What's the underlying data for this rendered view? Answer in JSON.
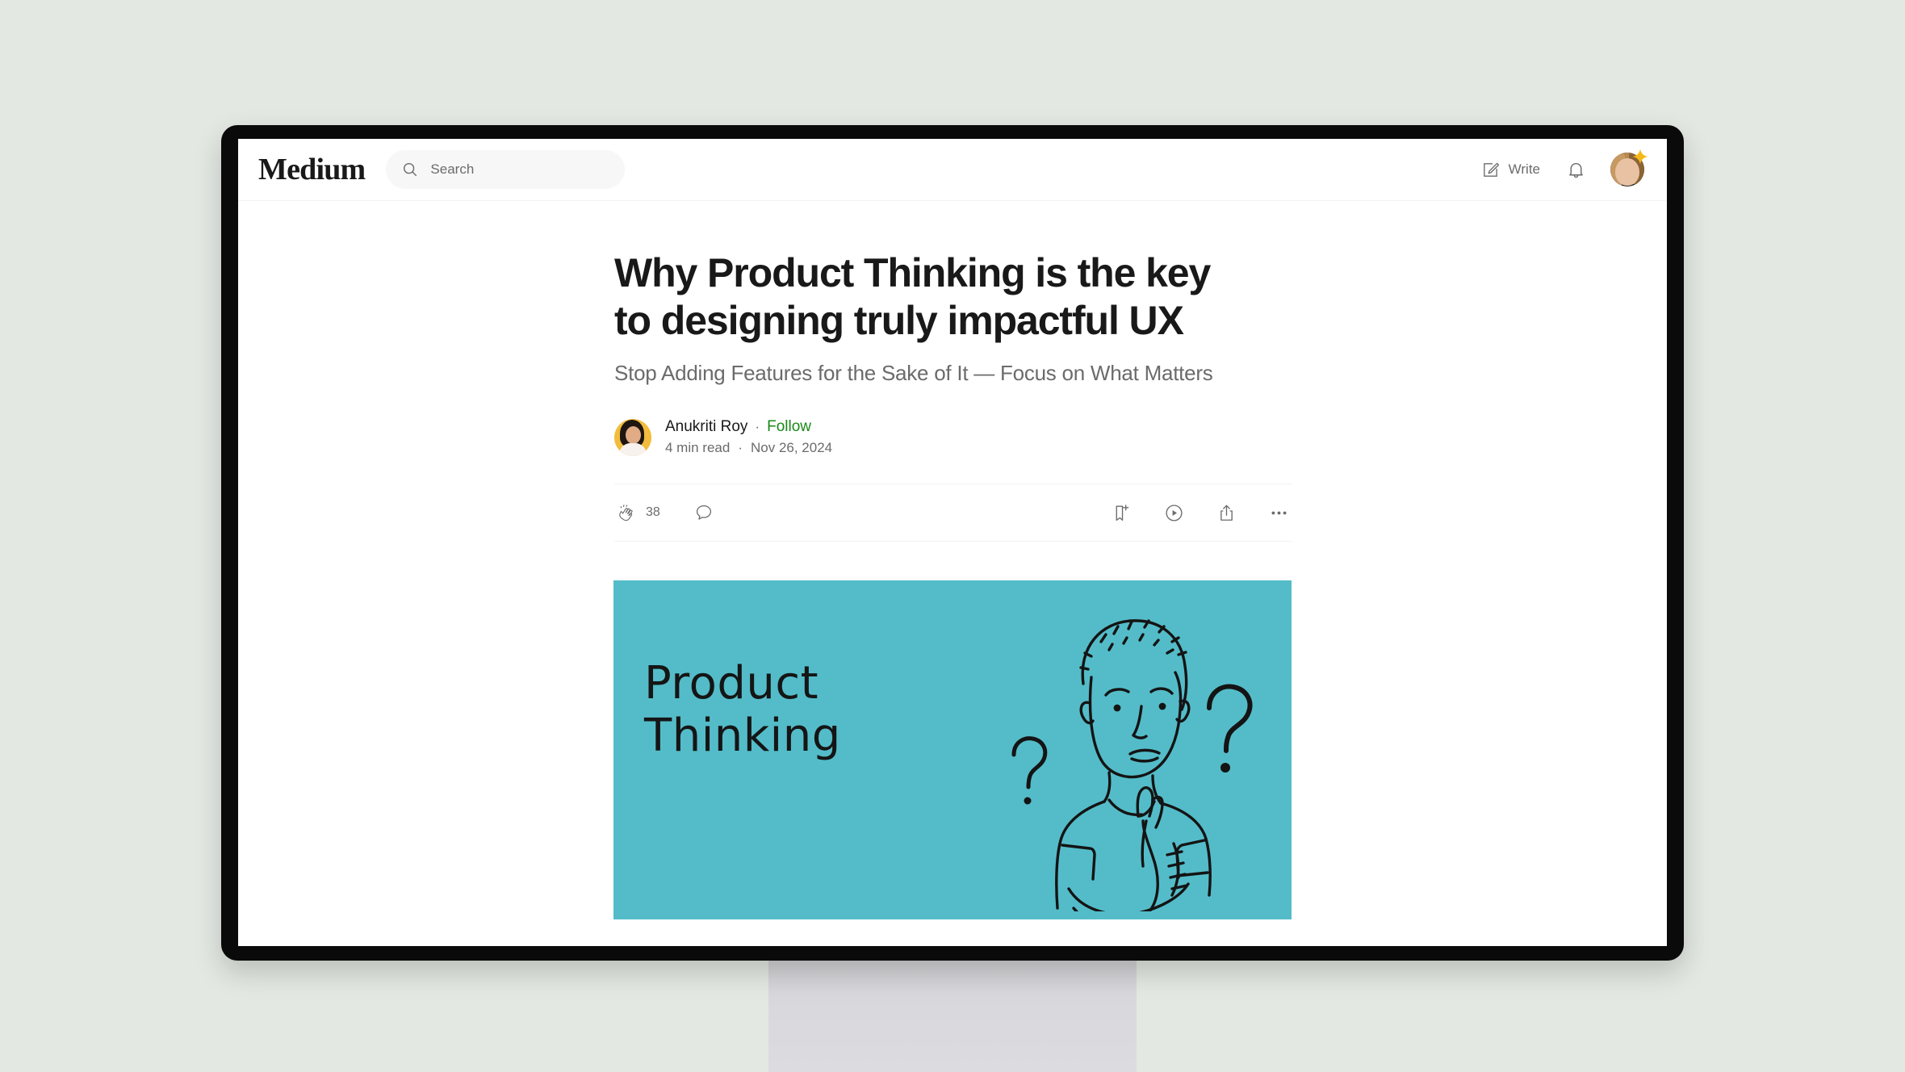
{
  "theme": {
    "page_background": "#e3e8e2",
    "bezel": "#0a0a0a",
    "stand": "#d8d8dc",
    "accent_green": "#1a8917",
    "hero_teal": "#54bcc9",
    "text_primary": "#191919",
    "text_secondary": "#6b6b6b",
    "sparkle_yellow": "#f5b816"
  },
  "nav": {
    "logo": "Medium",
    "search": {
      "placeholder": "Search",
      "value": "",
      "icon": "search-icon"
    },
    "write": {
      "label": "Write",
      "icon": "write-pencil-icon"
    },
    "notifications": {
      "icon": "bell-icon"
    },
    "avatar": {
      "name": "user-avatar",
      "badge_icon": "sparkle-icon"
    }
  },
  "article": {
    "title": "Why Product Thinking is the key to designing truly impactful UX",
    "subtitle": "Stop Adding Features for the Sake of It — Focus on What Matters",
    "author": {
      "name": "Anukriti Roy",
      "follow_label": "Follow",
      "separator": "·"
    },
    "meta": {
      "read_time": "4 min read",
      "separator": "·",
      "date": "Nov 26, 2024"
    },
    "actions": {
      "clap": {
        "icon": "clap-icon",
        "count": "38"
      },
      "comment": {
        "icon": "comment-icon",
        "count": ""
      },
      "save": {
        "icon": "bookmark-plus-icon"
      },
      "listen": {
        "icon": "play-circle-icon"
      },
      "share": {
        "icon": "share-icon"
      },
      "more": {
        "icon": "ellipsis-icon"
      }
    },
    "hero": {
      "alt": "Product Thinking illustration",
      "text": "Product\nThinking",
      "background_color": "#54bcc9",
      "illustration": "thinking-person-with-question-marks"
    }
  }
}
